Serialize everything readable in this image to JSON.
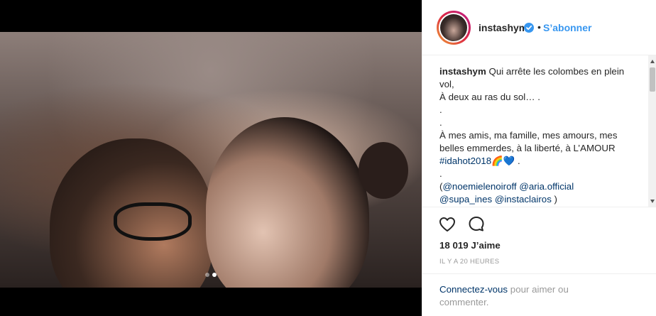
{
  "post": {
    "username": "instashym",
    "follow_label": "S’abonner",
    "separator": "•",
    "caption": {
      "username": "instashym",
      "line1_rest": "Qui arrête les colombes en plein vol,",
      "line2": "À deux au ras du sol… .",
      "line3": ".",
      "line4": ".",
      "line5": "À mes amis, ma famille, mes amours, mes belles emmerdes, à la liberté, à L’AMOUR",
      "hashtag": "#idahot2018",
      "hashtag_suffix": "🌈💙 .",
      "line7": ".",
      "mentions_open": "(",
      "mention1": "@noemielenoiroff",
      "mention2": "@aria.official",
      "mention3": "@supa_ines",
      "mention4": "@instaclairos",
      "mentions_close": ")"
    },
    "likes": "18 019 J’aime",
    "timestamp": "IL Y A 20 HEURES",
    "login_link": "Connectez-vous",
    "login_rest": "pour aimer ou commenter."
  },
  "carousel": {
    "total": 2,
    "active": 2
  },
  "icons": {
    "like": "heart-icon",
    "comment": "comment-icon",
    "verified": "verified-badge-icon"
  },
  "colors": {
    "accent": "#3897f0",
    "link": "#003569",
    "muted": "#999999"
  }
}
